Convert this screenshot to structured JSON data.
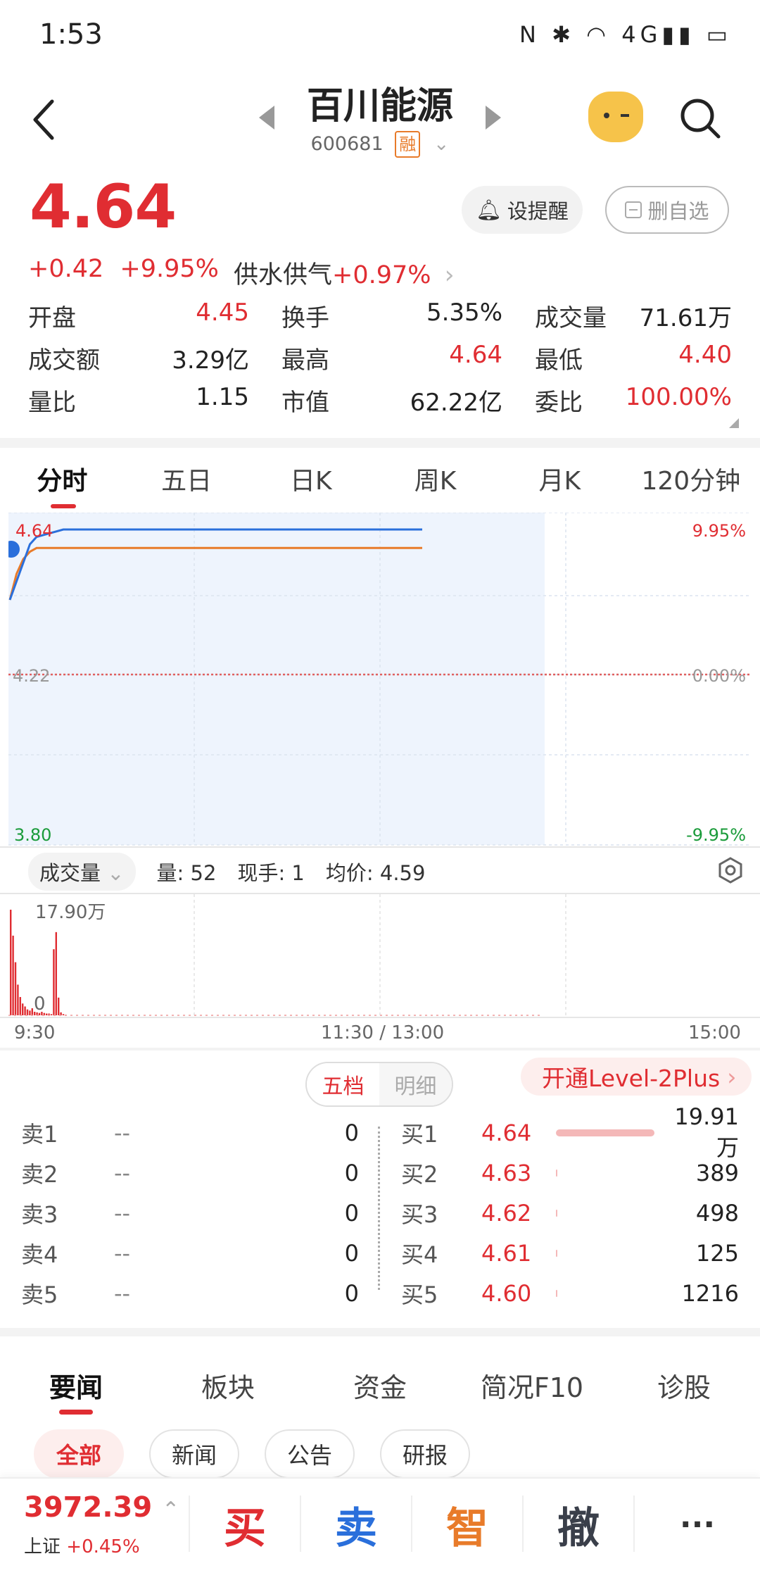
{
  "status_bar": {
    "time": "1:53",
    "icons": "N ✱ ◠ 4G▮▮ ▭"
  },
  "header": {
    "title": "百川能源",
    "code": "600681",
    "badge": "融"
  },
  "quote": {
    "price": "4.64",
    "change": "+0.42",
    "change_pct": "+9.95%",
    "sector": "供水供气",
    "sector_pct": "+0.97%",
    "alert_label": "设提醒",
    "remove_label": "删自选"
  },
  "stats": [
    [
      {
        "label": "开盘",
        "value": "4.45",
        "red": true
      },
      {
        "label": "换手",
        "value": "5.35%",
        "red": false
      },
      {
        "label": "成交量",
        "value": "71.61万",
        "red": false
      }
    ],
    [
      {
        "label": "成交额",
        "value": "3.29亿",
        "red": false
      },
      {
        "label": "最高",
        "value": "4.64",
        "red": true
      },
      {
        "label": "最低",
        "value": "4.40",
        "red": true
      }
    ],
    [
      {
        "label": "量比",
        "value": "1.15",
        "red": false
      },
      {
        "label": "市值",
        "value": "62.22亿",
        "red": false
      },
      {
        "label": "委比",
        "value": "100.00%",
        "red": true
      }
    ]
  ],
  "chart_tabs": [
    "分时",
    "五日",
    "日K",
    "周K",
    "月K",
    "120分钟"
  ],
  "chart_data": {
    "type": "line",
    "price_axis": {
      "top": "4.64",
      "mid": "4.22",
      "bottom": "3.80"
    },
    "pct_axis": {
      "top": "9.95%",
      "mid": "0.00%",
      "bottom": "-9.95%"
    },
    "ylim": [
      3.8,
      4.64
    ],
    "price_series": [
      4.45,
      4.5,
      4.55,
      4.6,
      4.62,
      4.64,
      4.64,
      4.64,
      4.64
    ],
    "avg_series": [
      4.45,
      4.52,
      4.56,
      4.58,
      4.59,
      4.59,
      4.59,
      4.59,
      4.59
    ],
    "volume_max_label": "17.90万",
    "volume_zero_label": "0",
    "volume_bars": [
      17.9,
      13.5,
      9.0,
      5.2,
      3.1,
      2.0,
      1.5,
      1.0,
      0.8,
      1.2,
      0.6,
      0.5,
      0.4,
      0.6,
      0.4,
      0.3,
      0.3,
      0.2,
      11.2,
      14.1,
      3.0,
      0.5,
      0.2,
      0.1
    ],
    "time_labels": [
      "9:30",
      "11:30 / 13:00",
      "15:00"
    ]
  },
  "volume_info": {
    "chip": "成交量",
    "qty": "量: 52",
    "hand": "现手: 1",
    "avg": "均价: 4.59"
  },
  "orderbook": {
    "seg_on": "五档",
    "seg_off": "明细",
    "level2": "开通Level-2Plus",
    "sell": [
      {
        "label": "卖1",
        "price": "--",
        "vol": "0"
      },
      {
        "label": "卖2",
        "price": "--",
        "vol": "0"
      },
      {
        "label": "卖3",
        "price": "--",
        "vol": "0"
      },
      {
        "label": "卖4",
        "price": "--",
        "vol": "0"
      },
      {
        "label": "卖5",
        "price": "--",
        "vol": "0"
      }
    ],
    "buy": [
      {
        "label": "买1",
        "price": "4.64",
        "vol": "19.91万",
        "bar": 1.0
      },
      {
        "label": "买2",
        "price": "4.63",
        "vol": "389",
        "bar": 0.0
      },
      {
        "label": "买3",
        "price": "4.62",
        "vol": "498",
        "bar": 0.0
      },
      {
        "label": "买4",
        "price": "4.61",
        "vol": "125",
        "bar": 0.0
      },
      {
        "label": "买5",
        "price": "4.60",
        "vol": "1216",
        "bar": 0.01
      }
    ]
  },
  "news_tabs": [
    "要闻",
    "板块",
    "资金",
    "简况F10",
    "诊股"
  ],
  "news_pills": [
    "全部",
    "新闻",
    "公告",
    "研报"
  ],
  "bottom_bar": {
    "index_value": "3972.39",
    "index_name": "上证",
    "index_pct": "+0.45%",
    "buy": "买",
    "sell": "卖",
    "smart": "智",
    "cancel": "撤",
    "more": "···"
  },
  "colors": {
    "red": "#e02d32",
    "green": "#1a9b3a",
    "blue": "#2a6fdb",
    "orange": "#e87b2a",
    "dark": "#3a3f4a"
  }
}
